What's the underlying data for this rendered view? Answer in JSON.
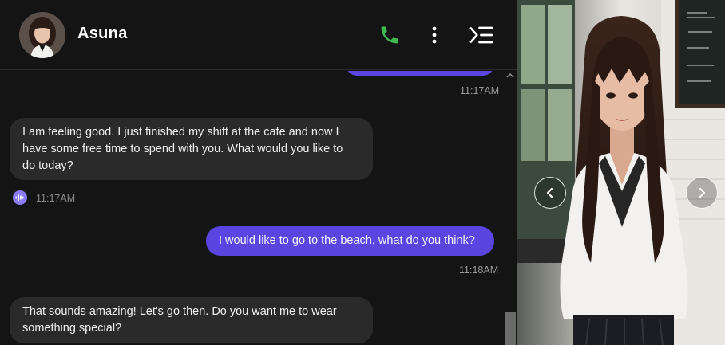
{
  "header": {
    "name": "Asuna",
    "call_icon": "phone-icon",
    "menu_icon": "more-vertical-icon",
    "sidebar_icon": "menu-collapse-icon",
    "call_color": "#3fb950"
  },
  "messages": [
    {
      "role": "user",
      "text": "",
      "time": "11:17AM"
    },
    {
      "role": "ai",
      "lines": [
        "I am feeling good. I just finished my shift at the cafe and now I",
        "have some free time to spend with you. What would you like to",
        "do today?"
      ],
      "time": "11:17AM",
      "audio_icon": "audio-wave-icon"
    },
    {
      "role": "user",
      "text": "I would like to go to the beach, what do you think?",
      "time": "11:18AM"
    },
    {
      "role": "ai",
      "lines": [
        "That sounds amazing! Let's go then. Do you want me to wear",
        "something special?"
      ]
    }
  ],
  "colors": {
    "user_bubble": "#5b45e0",
    "ai_bubble": "#2a2a2a",
    "background": "#141414",
    "audio_icon": "#8b7cf6"
  },
  "gallery": {
    "prev_icon": "chevron-left-icon",
    "next_icon": "chevron-right-icon"
  }
}
